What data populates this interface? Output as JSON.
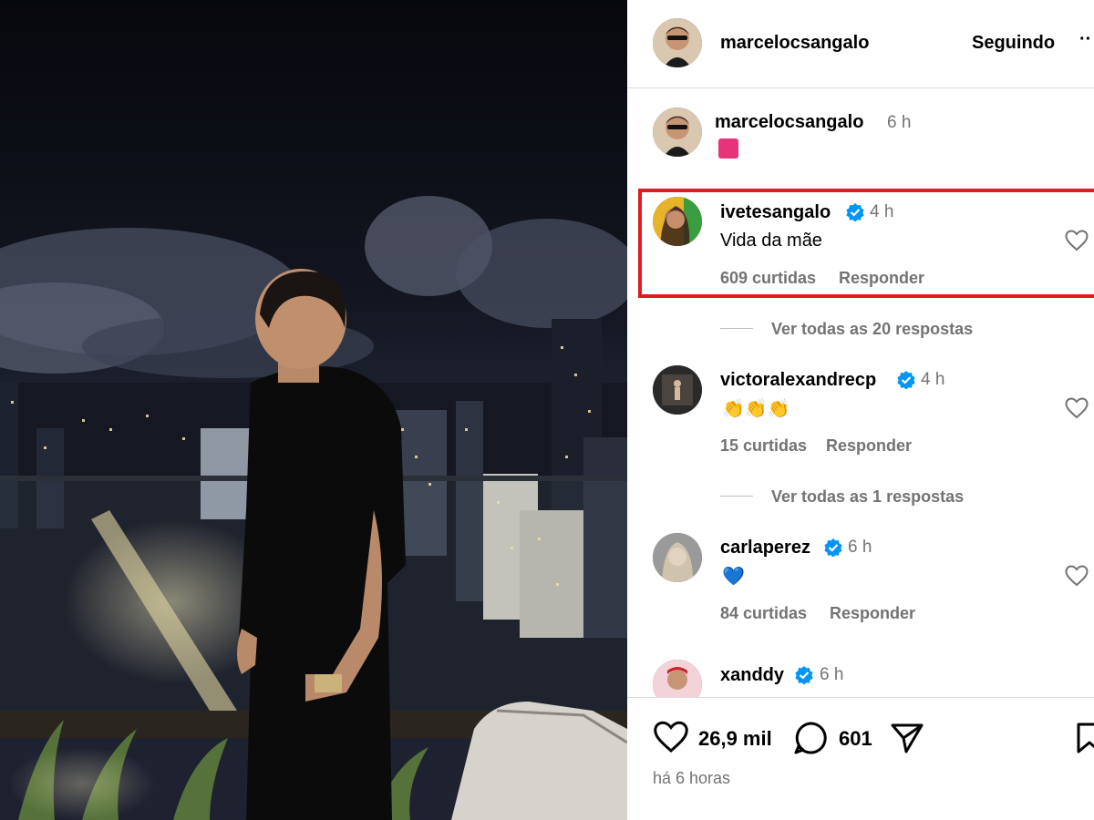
{
  "header": {
    "username": "marcelocsangalo",
    "follow_state": "Seguindo",
    "more_label": "··"
  },
  "caption": {
    "username": "marcelocsangalo",
    "time": "6 h"
  },
  "comments": [
    {
      "username": "ivetesangalo",
      "time": "4 h",
      "text": "Vida da mãe",
      "likes": "609 curtidas",
      "reply": "Responder",
      "view_replies": "Ver todas as 20 respostas",
      "verified": true
    },
    {
      "username": "victoralexandrecp",
      "time": "4 h",
      "text": "👏👏👏",
      "likes": "15 curtidas",
      "reply": "Responder",
      "view_replies": "Ver todas as 1 respostas",
      "verified": true
    },
    {
      "username": "carlaperez",
      "time": "6 h",
      "text": "💙",
      "likes": "84 curtidas",
      "reply": "Responder",
      "verified": true
    },
    {
      "username": "xanddy",
      "time": "6 h",
      "verified": true
    }
  ],
  "footer": {
    "likes": "26,9 mil",
    "comments": "601",
    "posted": "há 6 horas"
  },
  "colors": {
    "verified": "#0095f6",
    "highlight": "#e11b22",
    "muted": "#737373"
  }
}
